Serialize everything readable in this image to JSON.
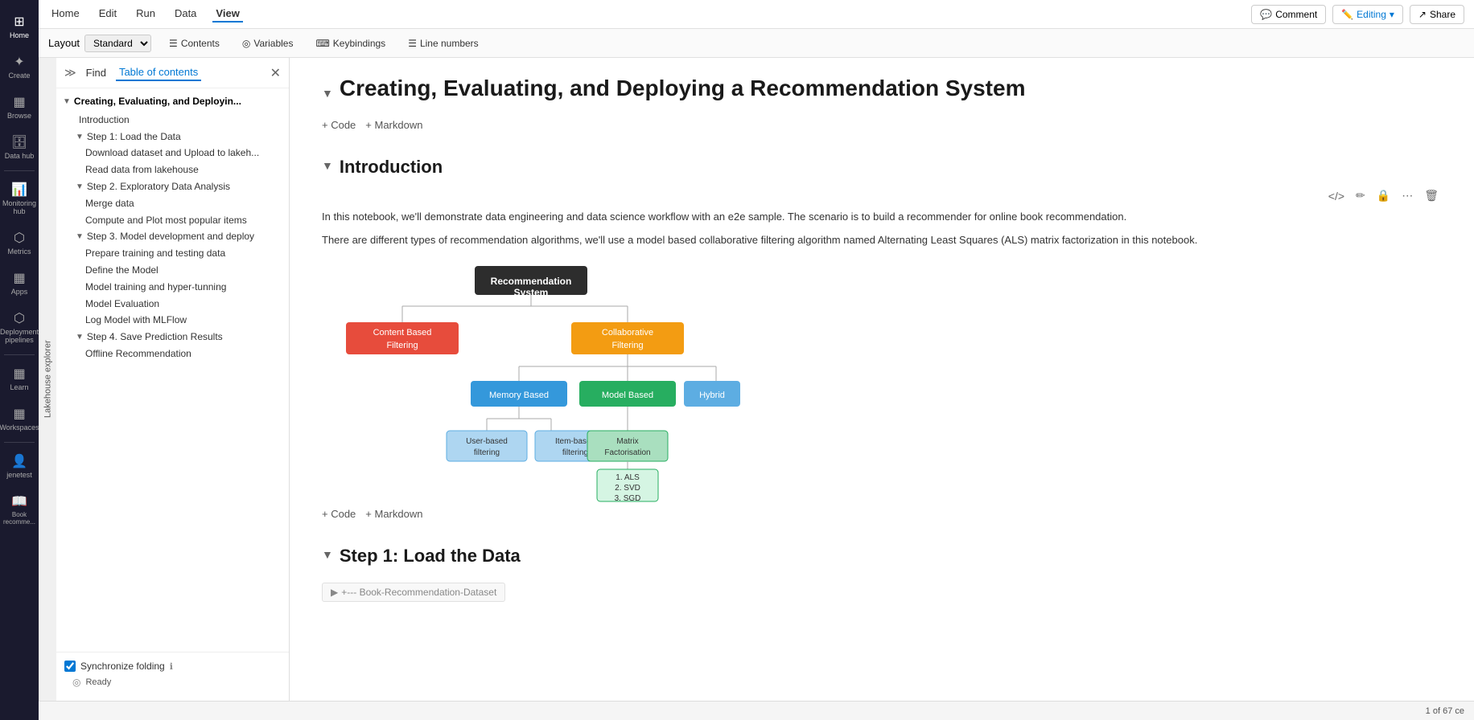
{
  "topbar": {
    "nav_items": [
      "Home",
      "Edit",
      "Run",
      "Data",
      "View"
    ],
    "active_nav": "View",
    "comment_label": "Comment",
    "editing_label": "Editing",
    "share_label": "Share"
  },
  "toolbar": {
    "layout_label": "Layout",
    "layout_value": "Standard",
    "contents_label": "Contents",
    "variables_label": "Variables",
    "keybindings_label": "Keybindings",
    "line_numbers_label": "Line numbers"
  },
  "sidebar": {
    "find_tab": "Find",
    "toc_tab": "Table of contents",
    "lakehouse_label": "Lakehouse explorer",
    "toc": {
      "root_label": "Creating, Evaluating, and Deployin...",
      "items": [
        {
          "level": 1,
          "label": "Introduction",
          "indent": 1
        },
        {
          "level": 1,
          "label": "Step 1: Load the Data",
          "indent": 1,
          "has_children": true
        },
        {
          "level": 2,
          "label": "Download dataset and Upload to lakeh...",
          "indent": 2
        },
        {
          "level": 2,
          "label": "Read data from lakehouse",
          "indent": 2
        },
        {
          "level": 1,
          "label": "Step 2. Exploratory Data Analysis",
          "indent": 1,
          "has_children": true
        },
        {
          "level": 2,
          "label": "Merge data",
          "indent": 2
        },
        {
          "level": 2,
          "label": "Compute and Plot most popular items",
          "indent": 2
        },
        {
          "level": 1,
          "label": "Step 3. Model development and deploy",
          "indent": 1,
          "has_children": true
        },
        {
          "level": 2,
          "label": "Prepare training and testing data",
          "indent": 2
        },
        {
          "level": 2,
          "label": "Define the Model",
          "indent": 2
        },
        {
          "level": 2,
          "label": "Model training and hyper-tunning",
          "indent": 2
        },
        {
          "level": 2,
          "label": "Model Evaluation",
          "indent": 2
        },
        {
          "level": 2,
          "label": "Log Model with MLFlow",
          "indent": 2
        },
        {
          "level": 1,
          "label": "Step 4. Save Prediction Results",
          "indent": 1,
          "has_children": true
        },
        {
          "level": 2,
          "label": "Offline Recommendation",
          "indent": 2
        }
      ]
    },
    "sync_folding_label": "Synchronize folding",
    "status_label": "Ready"
  },
  "notebook": {
    "title": "Creating, Evaluating, and Deploying a Recommendation System",
    "add_code": "+ Code",
    "add_markdown": "+ Markdown",
    "intro_title": "Introduction",
    "intro_text1": "In this notebook, we'll demonstrate data engineering and data science workflow with an e2e sample. The scenario is to build a recommender for online book recommendation.",
    "intro_text2": "There are different types of recommendation algorithms, we'll use a model based collaborative filtering algorithm named Alternating Least Squares (ALS) matrix factorization in this notebook.",
    "diagram": {
      "root_label": "Recommendation System",
      "left_label": "Content Based Filtering",
      "right_label": "Collaborative Filtering",
      "l1_label": "Memory Based",
      "l2_label": "Model Based",
      "l3_label": "Hybrid",
      "ll1_label": "User-based filtering",
      "ll2_label": "Item-based filtering",
      "lr1_label": "Matrix Factorisation",
      "lr1_sub": "1. ALS\n2. SVD\n3. SGD"
    },
    "step1_title": "Step 1: Load the Data",
    "code_hint": "+--- Book-Recommendation-Dataset"
  },
  "nav": {
    "items": [
      {
        "icon": "⊞",
        "label": "Home"
      },
      {
        "icon": "✦",
        "label": "Create"
      },
      {
        "icon": "⊞",
        "label": "Browse"
      },
      {
        "icon": "⊡",
        "label": "Data hub"
      },
      {
        "icon": "📊",
        "label": "Monitoring hub"
      },
      {
        "icon": "⬡",
        "label": "Metrics"
      },
      {
        "icon": "⊞",
        "label": "Apps"
      },
      {
        "icon": "⬡",
        "label": "Deployment pipelines"
      },
      {
        "icon": "⊞",
        "label": "Learn"
      },
      {
        "icon": "⊞",
        "label": "Workspaces"
      },
      {
        "icon": "👤",
        "label": "jenetest"
      },
      {
        "icon": "📖",
        "label": "Book recomme..."
      }
    ]
  },
  "bottom_bar": {
    "page_info": "1 of 67 ce"
  }
}
